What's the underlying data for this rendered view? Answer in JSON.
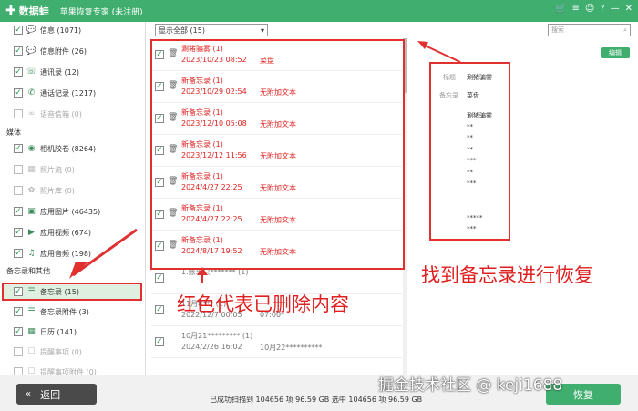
{
  "app": {
    "name": "数据蛙",
    "title": "苹果恢复专家 (未注册)",
    "window_icons": [
      "cart-icon",
      "menu-icon",
      "message-icon",
      "help-icon",
      "minimize-icon",
      "close-icon"
    ]
  },
  "sidebar": {
    "items_top": [
      {
        "label": "信息 (1071)",
        "checked": true,
        "icon": "message-icon",
        "dim": false
      },
      {
        "label": "信息附件 (26)",
        "checked": true,
        "icon": "message-icon",
        "dim": false
      },
      {
        "label": "通讯录 (12)",
        "checked": true,
        "icon": "contacts-icon",
        "dim": false
      },
      {
        "label": "通话记录 (1217)",
        "checked": true,
        "icon": "phone-icon",
        "dim": false
      },
      {
        "label": "语音信箱 (0)",
        "checked": false,
        "icon": "voicemail-icon",
        "dim": true
      }
    ],
    "section_media": "媒体",
    "items_media": [
      {
        "label": "相机胶卷 (8264)",
        "checked": true,
        "icon": "camera-icon",
        "dim": false
      },
      {
        "label": "照片流 (0)",
        "checked": false,
        "icon": "photostream-icon",
        "dim": true
      },
      {
        "label": "照片库 (0)",
        "checked": false,
        "icon": "photolib-icon",
        "dim": true
      },
      {
        "label": "应用图片 (46435)",
        "checked": true,
        "icon": "app-image-icon",
        "dim": false
      },
      {
        "label": "应用视频 (674)",
        "checked": true,
        "icon": "app-video-icon",
        "dim": false
      },
      {
        "label": "应用音频 (198)",
        "checked": true,
        "icon": "music-icon",
        "dim": false
      }
    ],
    "section_memo": "备忘录和其他",
    "items_memo": [
      {
        "label": "备忘录 (15)",
        "checked": true,
        "icon": "notes-icon",
        "dim": false
      },
      {
        "label": "备忘录附件 (3)",
        "checked": true,
        "icon": "notes-icon",
        "dim": false
      },
      {
        "label": "日历 (141)",
        "checked": true,
        "icon": "calendar-icon",
        "dim": false
      },
      {
        "label": "提醒事项 (0)",
        "checked": false,
        "icon": "reminder-icon",
        "dim": true
      },
      {
        "label": "提醒事项附件 (0)",
        "checked": false,
        "icon": "reminder-icon",
        "dim": true
      }
    ]
  },
  "list": {
    "filter_value": "显示全部 (15)",
    "rows": [
      {
        "l1": "涮猪骗雾 (1)",
        "l2": "2023/10/23 08:52",
        "l3": "菜盘",
        "deleted": true
      },
      {
        "l1": "新备忘录 (1)",
        "l2": "2023/10/29 02:54",
        "l3": "无附加文本",
        "deleted": true
      },
      {
        "l1": "新备忘录 (1)",
        "l2": "2023/12/10 05:08",
        "l3": "无附加文本",
        "deleted": true
      },
      {
        "l1": "新备忘录 (1)",
        "l2": "2023/12/12 11:56",
        "l3": "无附加文本",
        "deleted": true
      },
      {
        "l1": "新备忘录 (1)",
        "l2": "2024/4/27 22:25",
        "l3": "无附加文本",
        "deleted": true
      },
      {
        "l1": "新备忘录 (1)",
        "l2": "2024/4/27 22:25",
        "l3": "无附加文本",
        "deleted": true
      },
      {
        "l1": "新备忘录 (1)",
        "l2": "2024/8/17 19:52",
        "l3": "无附加文本",
        "deleted": true
      },
      {
        "l1": "1.账单只******* (1)",
        "l2": "",
        "l3": "",
        "deleted": false
      },
      {
        "l1": "11月8*** (1)",
        "l2": "2022/12/7 00:05",
        "l3": "07:00*",
        "deleted": false
      },
      {
        "l1": "10月21********* (1)",
        "l2": "2024/2/26 16:02",
        "l3": "10月22**********",
        "deleted": false
      }
    ]
  },
  "detail": {
    "search_placeholder": "搜索",
    "edit_label": "编辑",
    "title_label": "标题",
    "title_value": "涮猪骗雾",
    "memo_label": "备忘录",
    "memo_value": "菜盘",
    "body_lines": [
      "涮猪骗雾",
      "**",
      "**",
      "**",
      "***",
      "**",
      "***",
      "",
      "",
      "*****",
      "***"
    ]
  },
  "annotations": {
    "find_memo": "找到备忘录进行恢复",
    "red_deleted": "红色代表已删除内容"
  },
  "footer": {
    "back_label": "返回",
    "status": "已成功扫描到 104656 项 96.59 GB  选中 104656 项 96.59 GB",
    "recover_label": "恢复"
  },
  "watermark": "掘金技术社区 @ keji1688"
}
